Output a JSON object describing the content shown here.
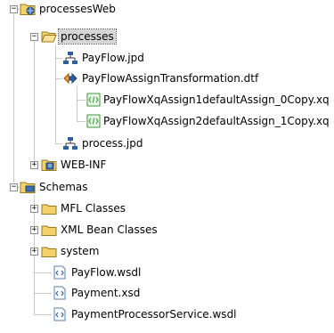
{
  "tree": {
    "nodes": [
      {
        "id": "processesWeb",
        "label": "processesWeb",
        "icon": "web-project-icon",
        "expanded": true
      },
      {
        "id": "processes",
        "label": "processes",
        "icon": "folder-open-icon",
        "expanded": true,
        "selected": true
      },
      {
        "id": "payflow-jpd",
        "label": "PayFlow.jpd",
        "icon": "process-icon"
      },
      {
        "id": "payflowassign-dtf",
        "label": "PayFlowAssignTransformation.dtf",
        "icon": "transformation-icon"
      },
      {
        "id": "xq-assign1",
        "label": "PayFlowXqAssign1defaultAssign_0Copy.xq",
        "icon": "xquery-icon"
      },
      {
        "id": "xq-assign2",
        "label": "PayFlowXqAssign2defaultAssign_1Copy.xq",
        "icon": "xquery-icon"
      },
      {
        "id": "process-jpd",
        "label": "process.jpd",
        "icon": "process-icon"
      },
      {
        "id": "web-inf",
        "label": "WEB-INF",
        "icon": "web-inf-folder-icon",
        "expanded": false
      },
      {
        "id": "schemas",
        "label": "Schemas",
        "icon": "schema-project-icon",
        "expanded": true
      },
      {
        "id": "mfl-classes",
        "label": "MFL Classes",
        "icon": "folder-icon",
        "expanded": false
      },
      {
        "id": "xml-bean-classes",
        "label": "XML Bean Classes",
        "icon": "folder-icon",
        "expanded": false
      },
      {
        "id": "system",
        "label": "system",
        "icon": "folder-icon",
        "expanded": false
      },
      {
        "id": "payflow-wsdl",
        "label": "PayFlow.wsdl",
        "icon": "wsdl-file-icon"
      },
      {
        "id": "payment-xsd",
        "label": "Payment.xsd",
        "icon": "xsd-file-icon"
      },
      {
        "id": "paymentprocessor-wsdl",
        "label": "PaymentProcessorService.wsdl",
        "icon": "wsdl-file-icon"
      }
    ]
  },
  "colors": {
    "folder": "#f2d36a",
    "folder_edge": "#9a7a1e",
    "project_blue": "#3d6fb0",
    "process_blue": "#2e5f9e",
    "xml_green": "#3a9a3a",
    "selection": "#d6d6d6"
  }
}
